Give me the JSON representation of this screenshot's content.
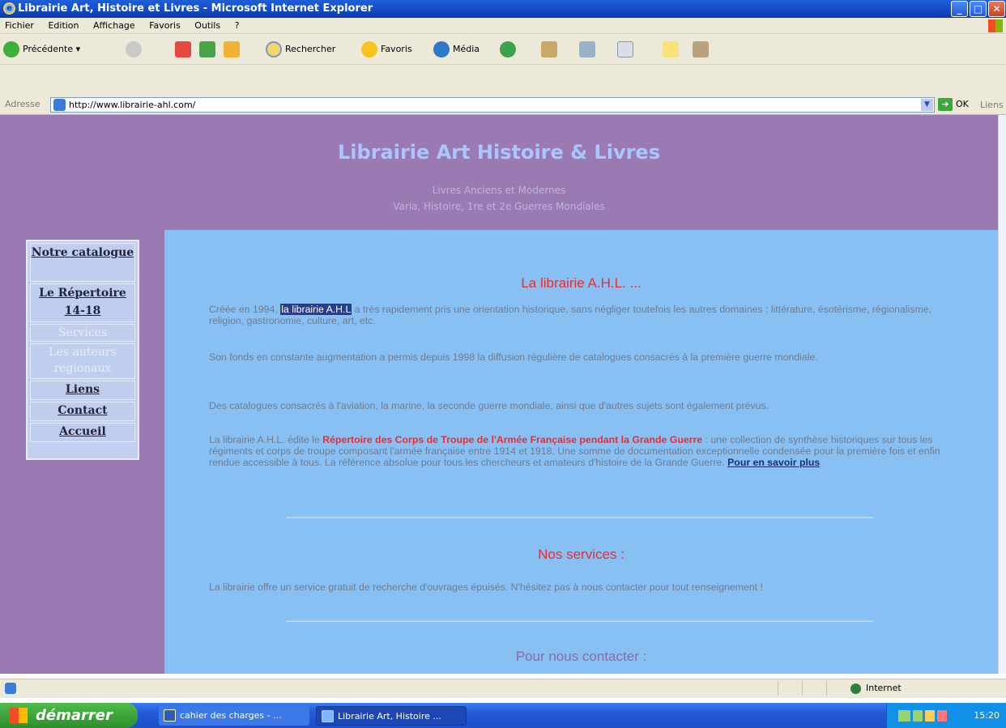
{
  "window": {
    "title": "Librairie Art, Histoire et Livres - Microsoft Internet Explorer",
    "minimize": "_",
    "maximize": "□",
    "close": "✕"
  },
  "menu": [
    "Fichier",
    "Edition",
    "Affichage",
    "Favoris",
    "Outils",
    "?"
  ],
  "toolbar": {
    "back": "Précédente",
    "back_arrow": "▾",
    "search": "Rechercher",
    "favorites": "Favoris",
    "media": "Média"
  },
  "address": {
    "label": "Adresse",
    "url": "http://www.librairie-ahl.com/",
    "go": "OK",
    "links": "Liens"
  },
  "site": {
    "title": "Librairie Art Histoire & Livres",
    "subtitle1": "Livres Anciens et Modernes",
    "subtitle2": "Varia, Histoire, 1re et 2e Guerres Mondiales"
  },
  "nav": [
    {
      "label": "Notre catalogue",
      "enabled": true
    },
    {
      "label": "Le Répertoire 14-18",
      "enabled": true
    },
    {
      "label": "Services",
      "enabled": false
    },
    {
      "label": "Les auteurs regionaux",
      "enabled": false
    },
    {
      "label": "Liens",
      "enabled": true
    },
    {
      "label": "Contact",
      "enabled": true
    },
    {
      "label": "Accueil",
      "enabled": true
    }
  ],
  "main": {
    "section1_title": "La librairie A.H.L. ...",
    "p1_before": "Créée en 1994,",
    "p1_highlight": "la librairie A.H.L",
    "p1_after": "a très rapidement pris une orientation historique, sans négliger toutefois les autres domaines : littérature, ésotérisme, régionalisme, religion, gastronomie, culture, art, etc.",
    "p2": "Son fonds en constante augmentation a permis depuis 1998 la diffusion régulière de catalogues consacrés à la première guerre mondiale.",
    "p3": "Des catalogues consacrés à l'aviation, la marine, la seconde guerre mondiale, ainsi que d'autres sujets sont également prévus.",
    "p4_before": "La librairie A.H.L. édite le",
    "p4_bold": "Répertoire des Corps de Troupe de l'Armée Française pendant la Grande Guerre",
    "p4_after": ": une collection de synthèse historiques sur tous les régiments et corps de troupe composant l'armée française entre 1914 et 1918. Une somme de documentation exceptionnelle condensée pour la première fois et enfin rendue accessible à tous. La référence absolue pour tous les chercheurs et amateurs d'histoire de la Grande Guerre.",
    "p4_link": "Pour en savoir plus",
    "section2_title": "Nos services :",
    "p5": "La librairie offre un service gratuit de recherche d'ouvrages épuisés. N'hésitez pas à nous contacter pour tout renseignement !",
    "section3_title": "Pour nous contacter :"
  },
  "status": {
    "zone": "Internet"
  },
  "taskbar": {
    "start": "démarrer",
    "tasks": [
      "cahier des charges - ...",
      "Librairie Art, Histoire ..."
    ],
    "clock": "15:20"
  }
}
